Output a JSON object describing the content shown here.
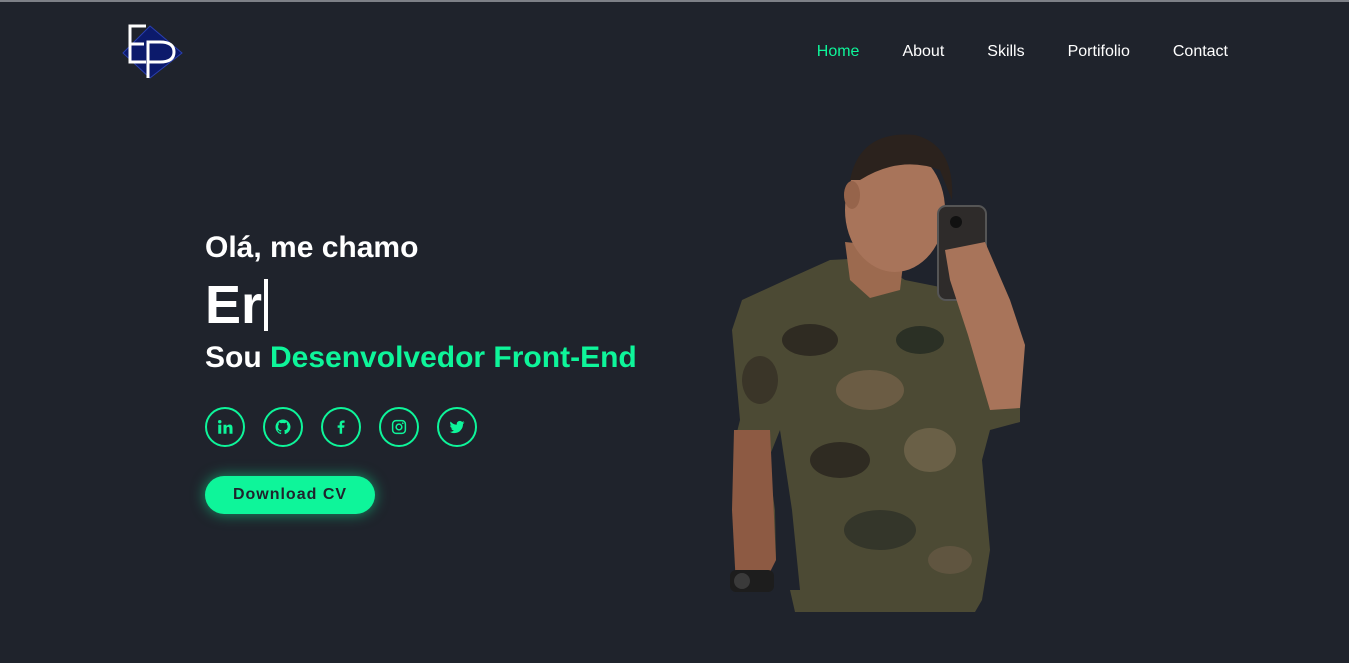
{
  "header": {
    "logo_icon": "ep-monogram-logo",
    "nav": [
      {
        "label": "Home",
        "active": true
      },
      {
        "label": "About",
        "active": false
      },
      {
        "label": "Skills",
        "active": false
      },
      {
        "label": "Portifolio",
        "active": false
      },
      {
        "label": "Contact",
        "active": false
      }
    ]
  },
  "hero": {
    "greeting": "Olá, me chamo",
    "name_typed": "Er",
    "role_prefix": "Sou",
    "role_highlight": "Desenvolvedor Front-End",
    "socials": [
      "linkedin-icon",
      "github-icon",
      "facebook-icon",
      "instagram-icon",
      "twitter-icon"
    ],
    "cv_button": "Download CV",
    "portrait": "profile-photo"
  },
  "colors": {
    "background": "#1f232c",
    "accent": "#0ef59a",
    "text": "#ffffff"
  }
}
